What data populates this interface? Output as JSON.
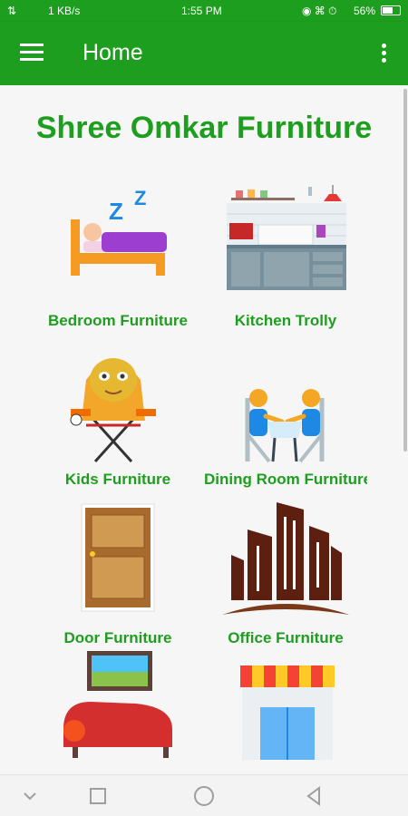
{
  "status_bar": {
    "speed": "1 KB/s",
    "time": "1:55 PM",
    "battery": "56%",
    "icons": [
      "usb-icon",
      "signal-icon",
      "data-sync-icon",
      "wifi-icon",
      "alarm-icon",
      "battery-icon"
    ]
  },
  "app_bar": {
    "title": "Home",
    "menu_icon": "hamburger-icon",
    "overflow_icon": "more-vert-icon"
  },
  "brand_title": "Shree Omkar Furniture",
  "categories": [
    {
      "label": "Bedroom Furniture",
      "icon": "bed-icon"
    },
    {
      "label": "Kitchen Trolly",
      "icon": "kitchen-icon"
    },
    {
      "label": "Kids Furniture",
      "icon": "kids-chair-icon"
    },
    {
      "label": "Dining Room Furniture",
      "icon": "dining-icon"
    },
    {
      "label": "Door Furniture",
      "icon": "door-icon"
    },
    {
      "label": "Office Furniture",
      "icon": "office-building-icon"
    },
    {
      "label": "",
      "icon": "sofa-icon"
    },
    {
      "label": "",
      "icon": "shop-icon"
    }
  ],
  "nav_bar": {
    "icons": [
      "chevron-down-icon",
      "recents-icon",
      "home-icon",
      "back-icon"
    ]
  },
  "colors": {
    "primary": "#1e9e1e",
    "background": "#f6f6f6"
  }
}
